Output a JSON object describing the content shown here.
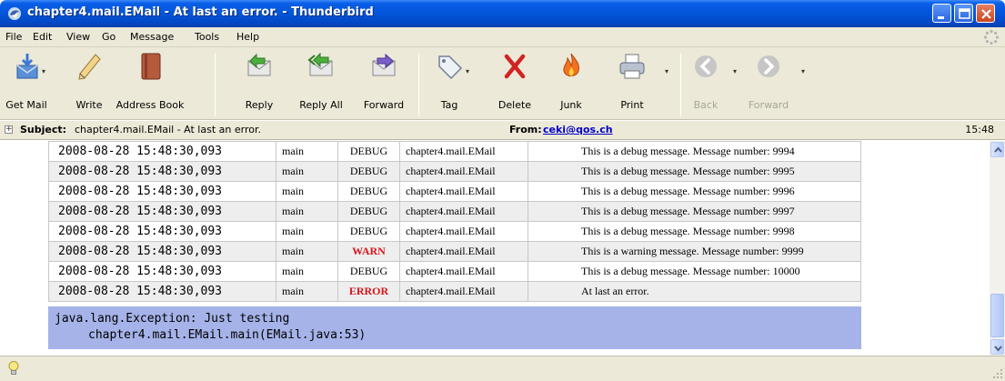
{
  "window": {
    "title": "chapter4.mail.EMail - At last an error. - Thunderbird",
    "accent": "#0355d9"
  },
  "menu": [
    "File",
    "Edit",
    "View",
    "Go",
    "Message",
    "Tools",
    "Help"
  ],
  "toolbar": {
    "get_mail": "Get Mail",
    "write": "Write",
    "address_book": "Address Book",
    "reply": "Reply",
    "reply_all": "Reply All",
    "forward": "Forward",
    "tag": "Tag",
    "delete": "Delete",
    "junk": "Junk",
    "print": "Print",
    "back": "Back",
    "forward_nav": "Forward"
  },
  "header": {
    "subject_label": "Subject:",
    "subject": "chapter4.mail.EMail - At last an error.",
    "from_label": "From:",
    "from": "ceki@qos.ch",
    "time": "15:48"
  },
  "log_rows": [
    {
      "date": "2008-08-28 15:48:30,093",
      "thread": "main",
      "level": "DEBUG",
      "logger": "chapter4.mail.EMail",
      "message": "This is a debug message. Message number: 9994"
    },
    {
      "date": "2008-08-28 15:48:30,093",
      "thread": "main",
      "level": "DEBUG",
      "logger": "chapter4.mail.EMail",
      "message": "This is a debug message. Message number: 9995"
    },
    {
      "date": "2008-08-28 15:48:30,093",
      "thread": "main",
      "level": "DEBUG",
      "logger": "chapter4.mail.EMail",
      "message": "This is a debug message. Message number: 9996"
    },
    {
      "date": "2008-08-28 15:48:30,093",
      "thread": "main",
      "level": "DEBUG",
      "logger": "chapter4.mail.EMail",
      "message": "This is a debug message. Message number: 9997"
    },
    {
      "date": "2008-08-28 15:48:30,093",
      "thread": "main",
      "level": "DEBUG",
      "logger": "chapter4.mail.EMail",
      "message": "This is a debug message. Message number: 9998"
    },
    {
      "date": "2008-08-28 15:48:30,093",
      "thread": "main",
      "level": "WARN",
      "logger": "chapter4.mail.EMail",
      "message": "This is a warning message. Message number: 9999"
    },
    {
      "date": "2008-08-28 15:48:30,093",
      "thread": "main",
      "level": "DEBUG",
      "logger": "chapter4.mail.EMail",
      "message": "This is a debug message. Message number: 10000"
    },
    {
      "date": "2008-08-28 15:48:30,093",
      "thread": "main",
      "level": "ERROR",
      "logger": "chapter4.mail.EMail",
      "message": "At last an error."
    }
  ],
  "exception": {
    "line1": "java.lang.Exception: Just testing",
    "line2": "chapter4.mail.EMail.main(EMail.java:53)"
  },
  "colors": {
    "level_alert": "#d9141b",
    "exception_bg": "#a5b3e9"
  }
}
